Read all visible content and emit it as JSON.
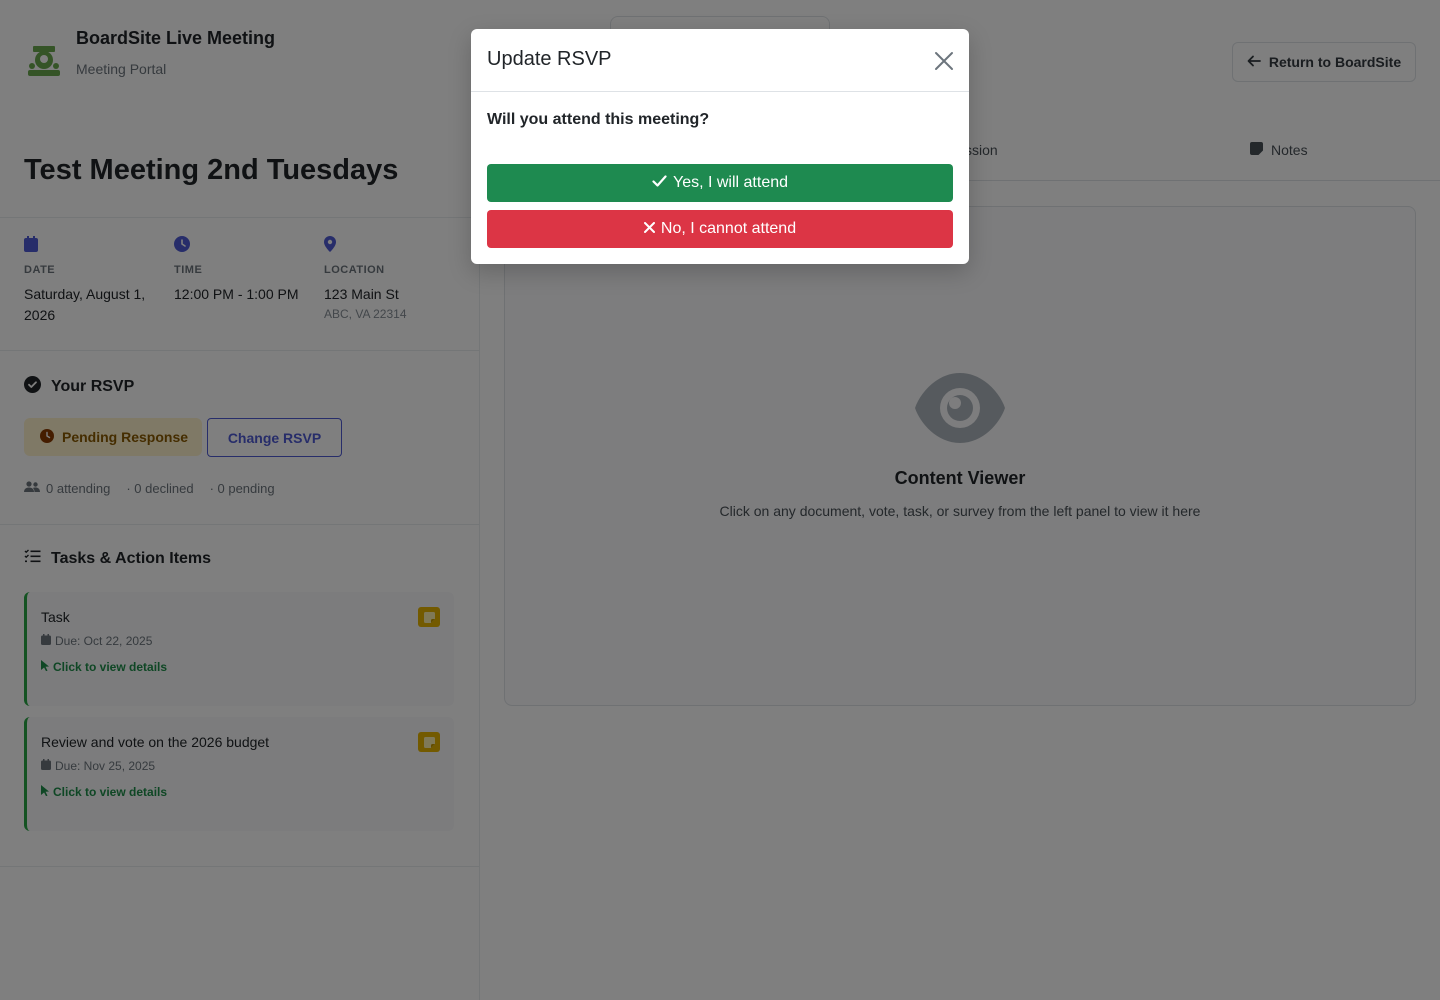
{
  "header": {
    "brand_title": "BoardSite Live Meeting",
    "brand_subtitle": "Meeting Portal",
    "return_label": "Return to BoardSite"
  },
  "meeting": {
    "title": "Test Meeting 2nd Tuesdays",
    "date_label": "DATE",
    "date_value": "Saturday, August 1, 2026",
    "time_label": "TIME",
    "time_value": "12:00 PM - 1:00 PM",
    "location_label": "LOCATION",
    "location_line1": "123 Main St",
    "location_line2": "ABC, VA 22314"
  },
  "rsvp": {
    "heading": "Your RSVP",
    "status": "Pending Response",
    "change_label": "Change RSVP",
    "attending": "0 attending",
    "declined": "· 0 declined",
    "pending": "· 0 pending"
  },
  "tasks": {
    "heading": "Tasks & Action Items",
    "items": [
      {
        "title": "Task",
        "due": "Due: Oct 22, 2025",
        "link": "Click to view details"
      },
      {
        "title": "Review and vote on the 2026 budget",
        "due": "Due: Nov 25, 2025",
        "link": "Click to view details"
      }
    ]
  },
  "tabs": {
    "discussion": "Discussion",
    "notes": "Notes"
  },
  "viewer": {
    "title": "Content Viewer",
    "description": "Click on any document, vote, task, or survey from the left panel to view it here"
  },
  "modal": {
    "title": "Update RSVP",
    "question": "Will you attend this meeting?",
    "yes_label": "Yes, I will attend",
    "no_label": "No, I cannot attend"
  },
  "colors": {
    "accent": "#4f5bd5",
    "success": "#1e8a50",
    "danger": "#dc3545",
    "warning": "#e6b400"
  }
}
